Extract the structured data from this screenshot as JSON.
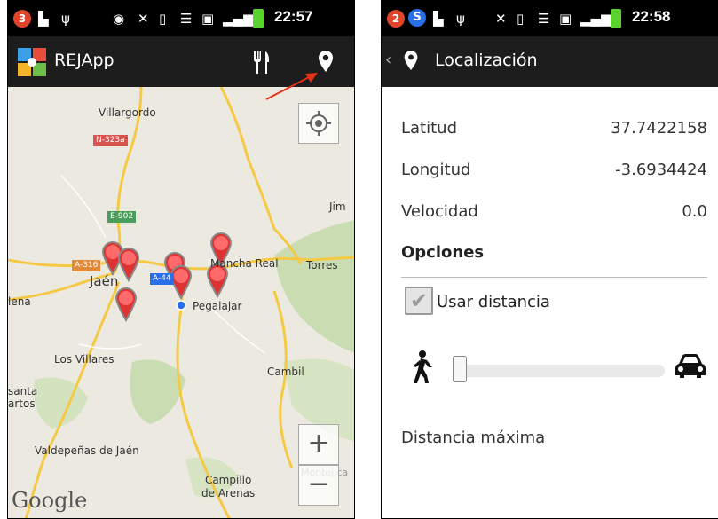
{
  "left_screen": {
    "status": {
      "notification_count": "3",
      "time": "22:57"
    },
    "app_title": "REJApp",
    "icons": [
      "app-logo-icon",
      "fork-knife-icon",
      "location-pin-icon",
      "my-location-icon",
      "zoom-in-icon",
      "zoom-out-icon"
    ],
    "map": {
      "places": [
        "Villargordo",
        "Jaén",
        "Mancha Real",
        "Torres",
        "Pegalajar",
        "Los Villares",
        "Cambil",
        "Valdepeñas de Jaén",
        "Campillo\nde Arenas",
        "Montejíca",
        "lena",
        "santa",
        "artos",
        "Jim"
      ],
      "roads": [
        "N-323a",
        "E-902",
        "A-316",
        "A-44"
      ],
      "attribution": "Google",
      "colors": {
        "land": "#ece9e0",
        "park": "#c9dcb2",
        "road": "#f6c944",
        "highway_shield": "#e08a3a",
        "pin": "#ee4c4c",
        "user_dot": "#2a6ee8"
      }
    },
    "zoom": {
      "in": "+",
      "out": "−"
    }
  },
  "right_screen": {
    "status": {
      "notification_count": "2",
      "time": "22:58"
    },
    "title": "Localización",
    "rows": [
      {
        "label": "Latitud",
        "value": "37.7422158"
      },
      {
        "label": "Longitud",
        "value": "-3.6934424"
      },
      {
        "label": "Velocidad",
        "value": "0.0"
      }
    ],
    "section": "Opciones",
    "checkbox": {
      "label": "Usar distancia",
      "checked": true
    },
    "slider": {
      "value": 0.0,
      "left_icon": "walking-person-icon",
      "right_icon": "car-icon"
    },
    "max_distance_label": "Distancia máxima"
  },
  "annotation": {
    "arrow_color": "#e53018"
  }
}
